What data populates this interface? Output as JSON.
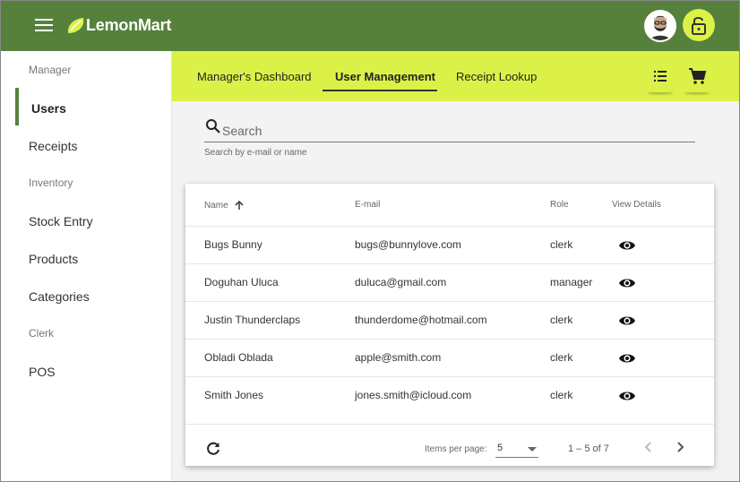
{
  "app": {
    "title": "LemonMart",
    "brand_color": "#55813d",
    "accent_color": "#dcf147"
  },
  "topbar": {
    "menu_icon": "menu-icon",
    "logo_icon": "lemon-icon",
    "avatar": "user-avatar",
    "lock_icon": "lock-open-icon"
  },
  "sidebar": {
    "sections": [
      {
        "header": "Manager",
        "items": [
          "Users",
          "Receipts"
        ]
      },
      {
        "header": "Inventory",
        "items": [
          "Stock Entry",
          "Products",
          "Categories"
        ]
      },
      {
        "header": "Clerk",
        "items": [
          "POS"
        ]
      }
    ],
    "active_item": "Users"
  },
  "subnav": {
    "tabs": [
      "Manager's Dashboard",
      "User Management",
      "Receipt Lookup"
    ],
    "active_tab": "User Management",
    "list_icon": "list-icon",
    "cart_icon": "shopping-cart-icon"
  },
  "search": {
    "placeholder": "Search",
    "hint": "Search by e-mail or name"
  },
  "table": {
    "columns": [
      "Name",
      "E-mail",
      "Role",
      "View Details"
    ],
    "sort_column": "Name",
    "sort_direction": "ascending",
    "rows": [
      {
        "name": "Bugs Bunny",
        "email": "bugs@bunnylove.com",
        "role": "clerk"
      },
      {
        "name": "Doguhan Uluca",
        "email": "duluca@gmail.com",
        "role": "manager"
      },
      {
        "name": "Justin Thunderclaps",
        "email": "thunderdome@hotmail.com",
        "role": "clerk"
      },
      {
        "name": "Obladi Oblada",
        "email": "apple@smith.com",
        "role": "clerk"
      },
      {
        "name": "Smith Jones",
        "email": "jones.smith@icloud.com",
        "role": "clerk"
      }
    ],
    "view_icon": "eye-icon"
  },
  "paginator": {
    "items_per_page_label": "Items per page:",
    "items_per_page": "5",
    "range_label": "1 – 5 of 7",
    "refresh_icon": "refresh-icon",
    "prev_icon": "chevron-left-icon",
    "next_icon": "chevron-right-icon"
  }
}
